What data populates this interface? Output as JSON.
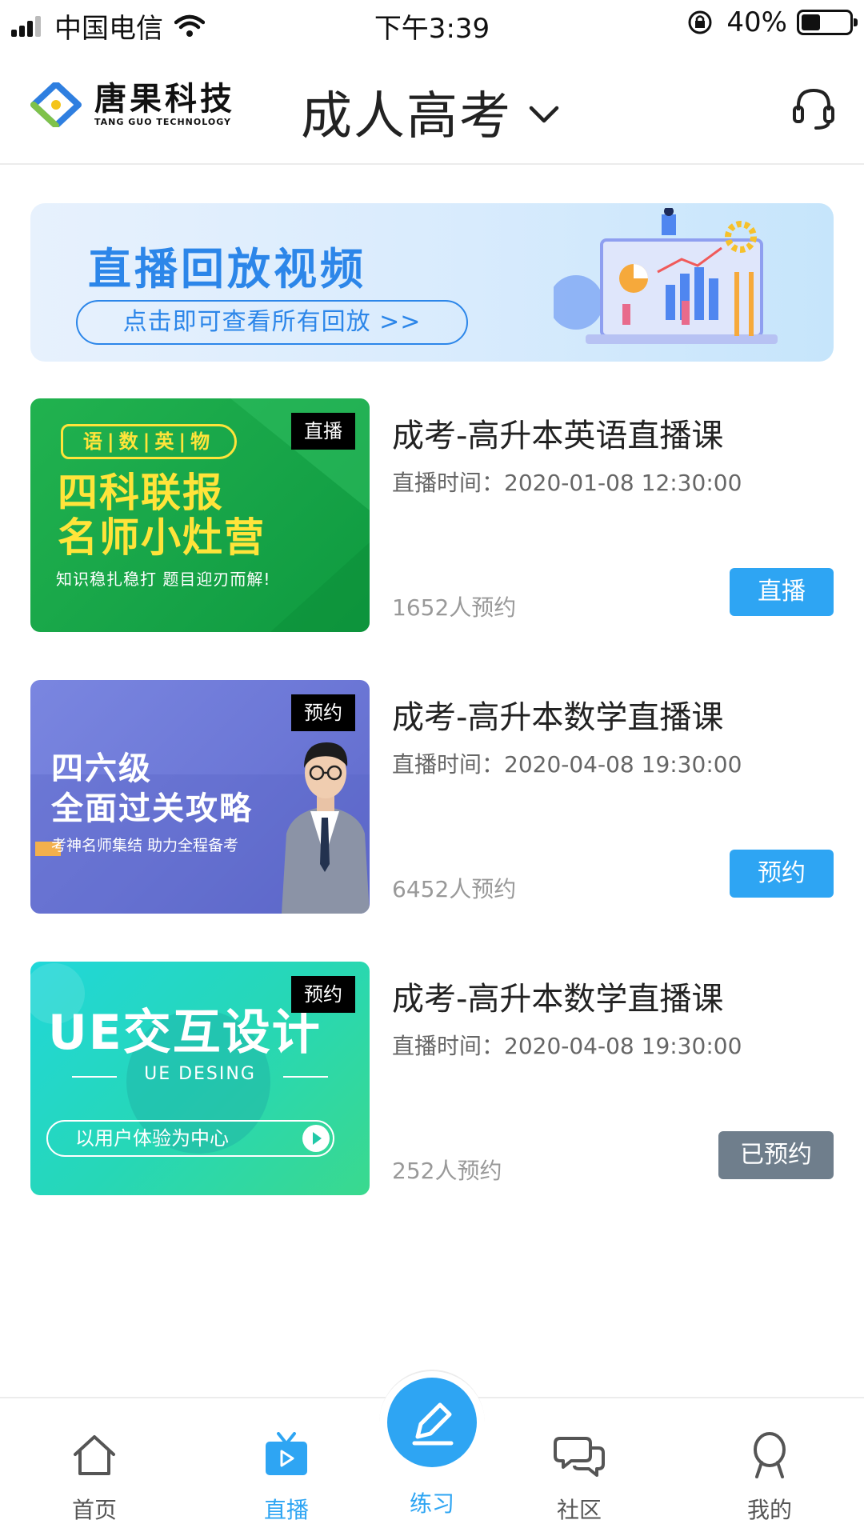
{
  "status_bar": {
    "carrier": "中国电信",
    "time": "下午3:39",
    "battery": "40%",
    "battery_level": 0.4
  },
  "header": {
    "logo_cn": "唐果科技",
    "logo_en": "TANG GUO TECHNOLOGY",
    "title": "成人高考"
  },
  "banner": {
    "title": "直播回放视频",
    "button": "点击即可查看所有回放 >>"
  },
  "courses": [
    {
      "tag": "直播",
      "title": "成考-高升本英语直播课",
      "time": "直播时间：2020-01-08  12:30:00",
      "count": "1652人预约",
      "button": "直播",
      "thumb": {
        "subjects": "语|数|英|物",
        "line1": "四科联报",
        "line2": "名师小灶营",
        "line3": "知识稳扎稳打  题目迎刃而解!"
      }
    },
    {
      "tag": "预约",
      "title": "成考-高升本数学直播课",
      "time": "直播时间：2020-04-08  19:30:00",
      "count": "6452人预约",
      "button": "预约",
      "thumb": {
        "line1": "四六级",
        "line2": "全面过关攻略",
        "line3": "考神名师集结 助力全程备考"
      }
    },
    {
      "tag": "预约",
      "title": "成考-高升本数学直播课",
      "time": "直播时间：2020-04-08  19:30:00",
      "count": "252人预约",
      "button": "已预约",
      "thumb": {
        "line1": "UE交互设计",
        "line2": "UE DESING",
        "line3": "以用户体验为中心"
      }
    }
  ],
  "tabbar": {
    "home": "首页",
    "live": "直播",
    "practice": "练习",
    "community": "社区",
    "mine": "我的",
    "active_color": "#2ea5f3"
  }
}
